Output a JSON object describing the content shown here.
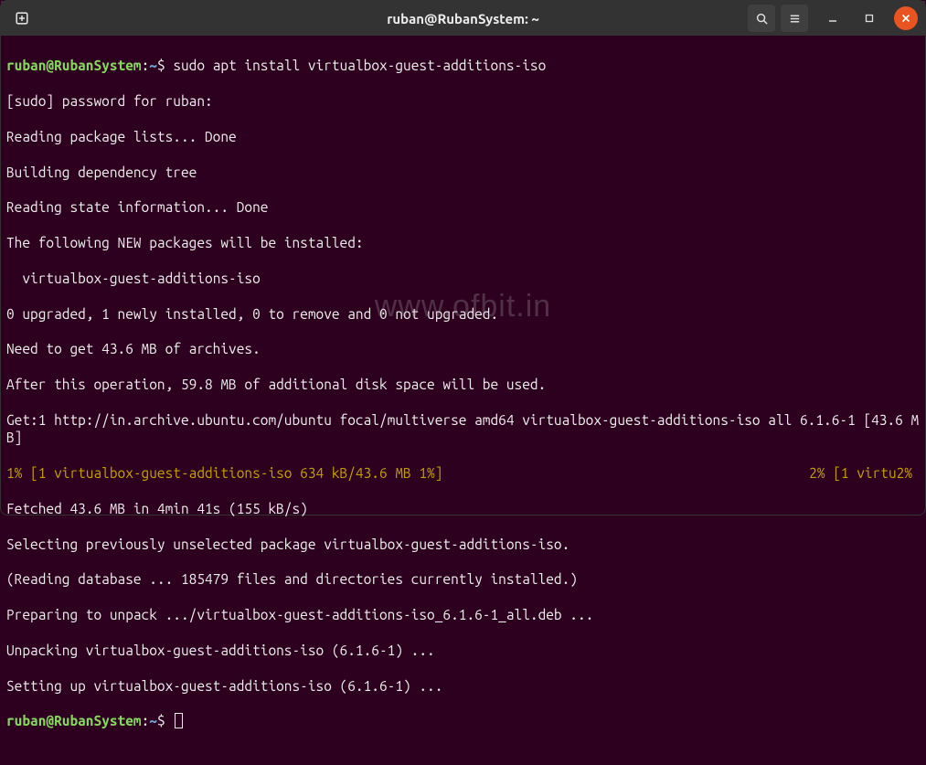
{
  "window": {
    "title": "ruban@RubanSystem: ~"
  },
  "prompt": {
    "user_host": "ruban@RubanSystem",
    "colon": ":",
    "path": "~",
    "dollar": "$ "
  },
  "command1": "sudo apt install virtualbox-guest-additions-iso",
  "lines": {
    "l1": "[sudo] password for ruban:",
    "l2": "Reading package lists... Done",
    "l3": "Building dependency tree",
    "l4": "Reading state information... Done",
    "l5": "The following NEW packages will be installed:",
    "l6": "  virtualbox-guest-additions-iso",
    "l7": "0 upgraded, 1 newly installed, 0 to remove and 0 not upgraded.",
    "l8": "Need to get 43.6 MB of archives.",
    "l9": "After this operation, 59.8 MB of additional disk space will be used.",
    "l10": "Get:1 http://in.archive.ubuntu.com/ubuntu focal/multiverse amd64 virtualbox-guest-additions-iso all 6.1.6-1 [43.6 MB]",
    "progress_left": "1% [1 virtualbox-guest-additions-iso 634 kB/43.6 MB 1%]",
    "progress_right": "2% [1 virtu2%",
    "l12": "Fetched 43.6 MB in 4min 41s (155 kB/s)",
    "l13": "Selecting previously unselected package virtualbox-guest-additions-iso.",
    "l14": "(Reading database ... 185479 files and directories currently installed.)",
    "l15": "Preparing to unpack .../virtualbox-guest-additions-iso_6.1.6-1_all.deb ...",
    "l16": "Unpacking virtualbox-guest-additions-iso (6.1.6-1) ...",
    "l17": "Setting up virtualbox-guest-additions-iso (6.1.6-1) ..."
  },
  "watermark": "www.ofbit.in"
}
